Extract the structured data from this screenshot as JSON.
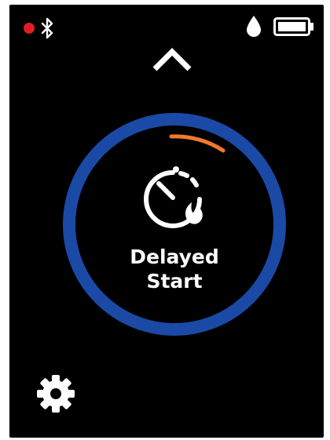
{
  "status_bar": {
    "recording_indicator_color": "#e02020",
    "bluetooth_icon": "bluetooth-icon",
    "water_icon": "water-drop-icon",
    "battery_icon": "battery-icon",
    "battery_level": 1.0
  },
  "navigation": {
    "up_icon": "chevron-up-icon"
  },
  "mode_dial": {
    "label": "Delayed\nStart",
    "ring_color": "#1a4aa6",
    "progress_color": "#f07a2a",
    "icon": "delayed-start-timer-icon"
  },
  "settings": {
    "icon": "gear-icon"
  }
}
